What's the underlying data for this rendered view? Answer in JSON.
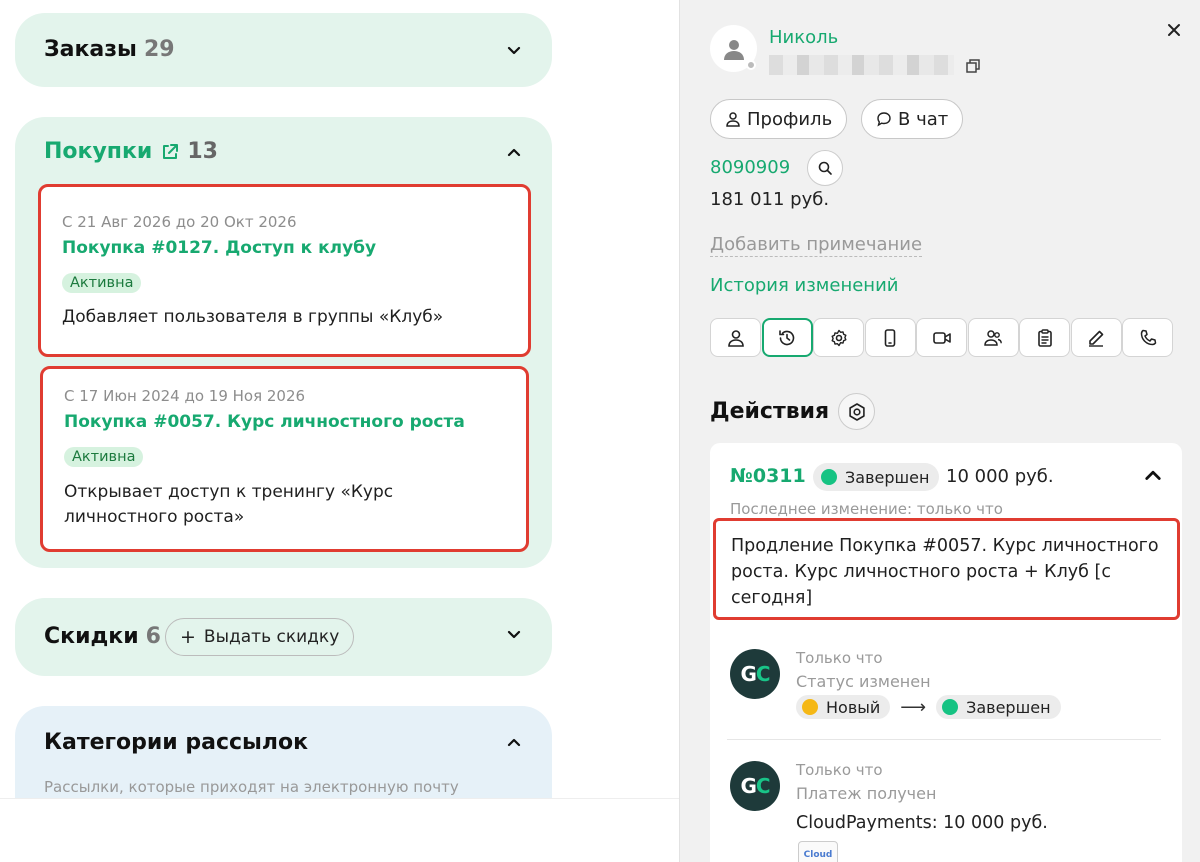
{
  "left": {
    "orders": {
      "title": "Заказы",
      "count": "29"
    },
    "purchases": {
      "title": "Покупки",
      "count": "13",
      "items": [
        {
          "dates": "С 21 Авг 2026 до 20 Окт 2026",
          "title": "Покупка #0127. Доступ к клубу",
          "status": "Активна",
          "desc": "Добавляет пользователя в группы «Клуб»"
        },
        {
          "dates": "С 17 Июн 2024 до 19 Ноя 2026",
          "title": "Покупка #0057. Курс личностного роста",
          "status": "Активна",
          "desc": "Открывает доступ к тренингу «Курс личностного роста»"
        }
      ]
    },
    "discounts": {
      "title": "Скидки",
      "count": "6",
      "give_label": "Выдать скидку"
    },
    "mailing": {
      "title": "Категории рассылок",
      "subtitle": "Рассылки, которые приходят на электронную почту"
    }
  },
  "right": {
    "user": {
      "name": "Николь"
    },
    "buttons": {
      "profile": "Профиль",
      "chat": "В чат"
    },
    "phone": "8090909",
    "amount": "181 011 руб.",
    "add_note": "Добавить примечание",
    "history": "История изменений",
    "actions": {
      "title": "Действия",
      "order": {
        "number": "№0311",
        "status": "Завершен",
        "sum": "10 000 руб.",
        "last_change": "Последнее изменение: только что",
        "product": "Продление Покупка #0057. Курс личностного роста. Курс личностного роста + Клуб [с сегодня]"
      },
      "history": [
        {
          "time": "Только что",
          "text": "Статус изменен",
          "from": "Новый",
          "to": "Завершен"
        },
        {
          "time": "Только что",
          "text": "Платеж получен",
          "payment": "CloudPayments: 10 000 руб."
        }
      ],
      "cloud_logo": "Cloud"
    }
  },
  "colors": {
    "accent": "#17a970",
    "highlight": "#e03c31",
    "card_bg": "#e3f4ec",
    "status_green": "#16c383",
    "status_yellow": "#f5b816"
  }
}
